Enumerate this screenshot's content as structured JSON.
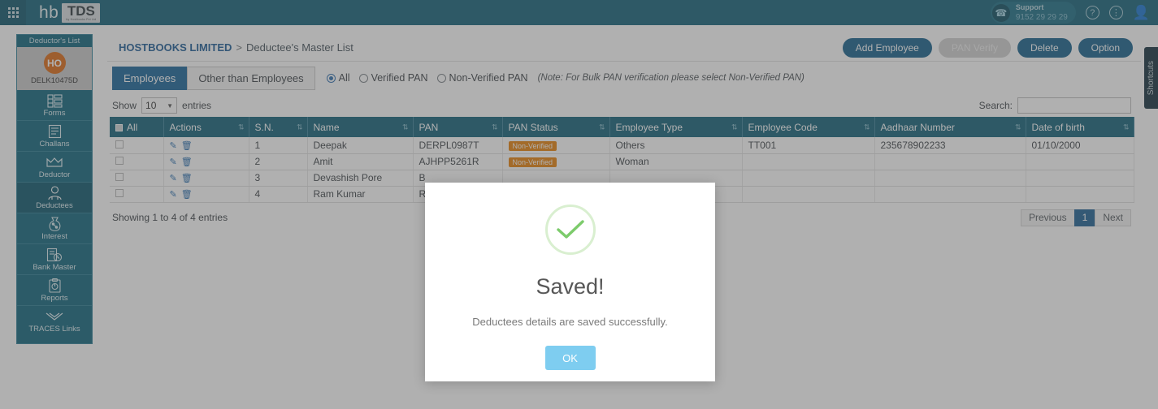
{
  "header": {
    "apps_icon": "grid-apps-icon",
    "brand_primary": "hb",
    "brand_secondary": "TDS",
    "brand_tagline": "by Hostbooks Pvt Ltd",
    "support_label": "Support",
    "support_number": "9152 29 29 29",
    "help_icon": "question-mark-icon",
    "info_icon": "info-icon",
    "user_icon": "user-avatar-icon"
  },
  "sidebar": {
    "title": "Deductor's List",
    "account": {
      "initials": "HO",
      "id": "DELK10475D"
    },
    "items": [
      {
        "label": "Forms",
        "icon": "forms-icon",
        "active": false
      },
      {
        "label": "Challans",
        "icon": "challans-icon",
        "active": false
      },
      {
        "label": "Deductor",
        "icon": "deductor-crown-icon",
        "active": false
      },
      {
        "label": "Deductees",
        "icon": "deductees-person-icon",
        "active": true
      },
      {
        "label": "Interest",
        "icon": "interest-moneybag-icon",
        "active": false
      },
      {
        "label": "Bank Master",
        "icon": "bank-master-icon",
        "active": false
      },
      {
        "label": "Reports",
        "icon": "reports-clipboard-icon",
        "active": false
      },
      {
        "label": "TRACES Links",
        "icon": "traces-links-icon",
        "active": false
      }
    ]
  },
  "breadcrumb": {
    "company": "HOSTBOOKS LIMITED",
    "separator": ">",
    "current": "Deductee's Master List"
  },
  "toolbar": {
    "add_employee": "Add Employee",
    "pan_verify": "PAN Verify",
    "delete": "Delete",
    "option": "Option"
  },
  "tabs": [
    {
      "label": "Employees",
      "active": true
    },
    {
      "label": "Other than Employees",
      "active": false
    }
  ],
  "filters": {
    "radios": [
      {
        "label": "All",
        "selected": true
      },
      {
        "label": "Verified PAN",
        "selected": false
      },
      {
        "label": "Non-Verified PAN",
        "selected": false
      }
    ],
    "note": "(Note: For Bulk PAN verification please select Non-Verified PAN)"
  },
  "controls": {
    "show_label": "Show",
    "entries_label": "entries",
    "page_size": "10",
    "search_label": "Search:",
    "search_value": "",
    "search_placeholder": ""
  },
  "table": {
    "select_all_label": "All",
    "columns": [
      "Actions",
      "S.N.",
      "Name",
      "PAN",
      "PAN Status",
      "Employee Type",
      "Employee Code",
      "Aadhaar Number",
      "Date of birth"
    ],
    "edit_icon": "edit-pencil-icon",
    "delete_icon": "delete-trash-icon",
    "rows": [
      {
        "sn": "1",
        "name": "Deepak",
        "pan": "DERPL0987T",
        "pan_status": "Non-Verified",
        "employee_type": "Others",
        "employee_code": "TT001",
        "aadhaar": "235678902233",
        "dob": "01/10/2000"
      },
      {
        "sn": "2",
        "name": "Amit",
        "pan": "AJHPP5261R",
        "pan_status": "Non-Verified",
        "employee_type": "Woman",
        "employee_code": "",
        "aadhaar": "",
        "dob": ""
      },
      {
        "sn": "3",
        "name": "Devashish Pore",
        "pan": "B",
        "pan_status": "",
        "employee_type": "",
        "employee_code": "",
        "aadhaar": "",
        "dob": ""
      },
      {
        "sn": "4",
        "name": "Ram Kumar",
        "pan": "R",
        "pan_status": "",
        "employee_type": "",
        "employee_code": "",
        "aadhaar": "",
        "dob": ""
      }
    ]
  },
  "footer": {
    "info": "Showing 1 to 4 of 4 entries",
    "previous": "Previous",
    "page_one": "1",
    "next": "Next"
  },
  "shortcuts_tab": {
    "label": "Shortcuts"
  },
  "modal": {
    "icon": "success-check-icon",
    "title": "Saved!",
    "message": "Deductees details are saved successfully.",
    "ok_label": "OK"
  },
  "colors": {
    "header_teal": "#136279",
    "sidebar_teal": "#10647c",
    "accent_blue": "#17628d",
    "badge_orange": "#e8820c",
    "avatar_orange": "#dd6b15",
    "modal_ok_blue": "#7ecdf0",
    "success_green": "#7ccb6b"
  }
}
